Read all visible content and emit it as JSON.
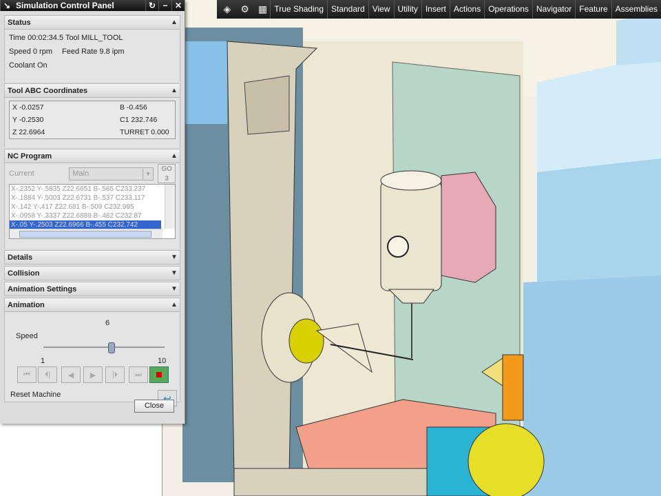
{
  "window": {
    "title": "Simulation Control Panel"
  },
  "toolbar": {
    "menu": [
      "True Shading",
      "Standard",
      "View",
      "Utility",
      "Insert",
      "Actions",
      "Operations",
      "Navigator",
      "Feature",
      "Assemblies"
    ]
  },
  "status": {
    "header": "Status",
    "line1": "Time 00:02:34.5 Tool MILL_TOOL",
    "speed": "Speed 0 rpm",
    "feed": "Feed Rate 9.8 ipm",
    "coolant": "Coolant On"
  },
  "coords": {
    "header": "Tool ABC Coordinates",
    "x": "X -0.0257",
    "b": "B -0.456",
    "y": "Y -0.2530",
    "c1": "C1 232.746",
    "z": "Z 22.6964",
    "turret": "TURRET 0.000"
  },
  "nc": {
    "header": "NC Program",
    "current_label": "Current",
    "current_value": "Main",
    "go_label": "GO",
    "lines": [
      "X-.2352 Y-.5835 Z22.6651 B-.565 C233.237",
      "X-.1884 Y-.5003 Z22.6731 B-.537 C233.117",
      "X-.142 Y-.417 Z22.681 B-.509 C232.995",
      "X-.0958 Y-.3337 Z22.6889 B-.482 C232.87",
      "X-.05 Y-.2503 Z22.6966 B-.455 C232.742"
    ]
  },
  "sections": {
    "details": "Details",
    "collision": "Collision",
    "animation_settings": "Animation Settings",
    "animation": "Animation"
  },
  "animation": {
    "speed_label": "Speed",
    "speed_value": "6",
    "speed_min": "1",
    "speed_max": "10",
    "speed_level": 6,
    "reset_label": "Reset Machine"
  },
  "buttons": {
    "close": "Close"
  },
  "colors": {
    "selection": "#3366cc",
    "stop": "#5aa85a"
  }
}
